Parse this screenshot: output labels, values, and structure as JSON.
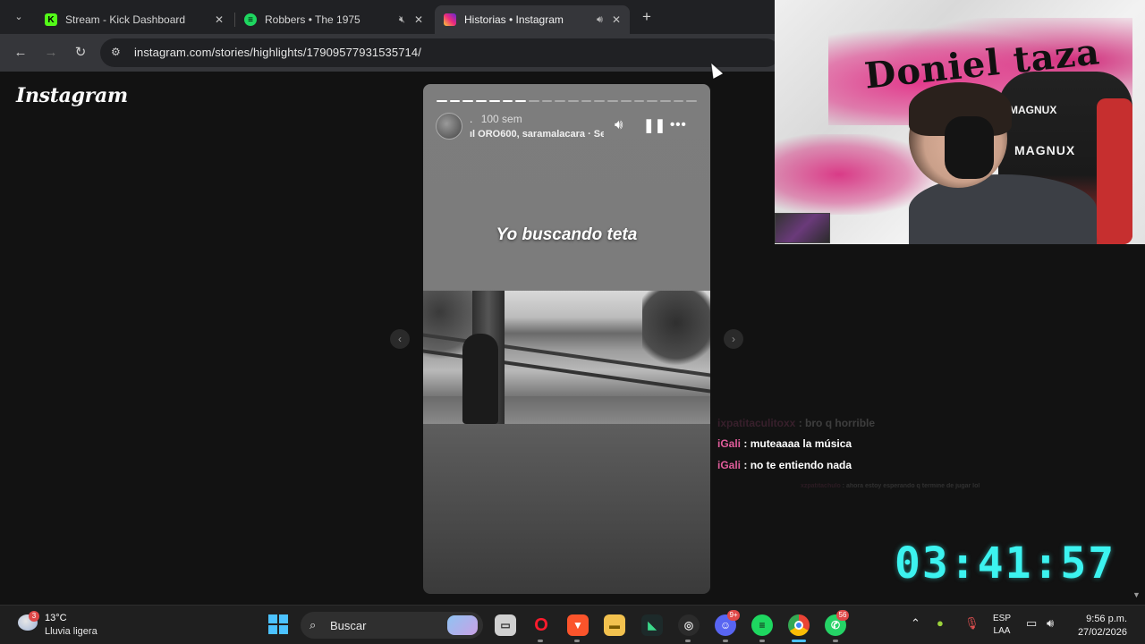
{
  "browser": {
    "tabs": [
      {
        "label": "Stream - Kick Dashboard",
        "favicon": "kick-icon",
        "color": "#53fc18",
        "active": false
      },
      {
        "label": "Robbers • The 1975",
        "favicon": "spotify-icon",
        "color": "#1ed760",
        "active": false
      },
      {
        "label": "Historias • Instagram",
        "favicon": "instagram-icon",
        "color": "#e1306c",
        "active": true
      }
    ],
    "url": "instagram.com/stories/highlights/17909577931535714/"
  },
  "instagram": {
    "logo": "Instagram",
    "story": {
      "username": ".",
      "time": "100 sem",
      "music": "ORO600, saramalacara · Se",
      "caption": "Yo buscando teta",
      "progress_done": 7,
      "progress_total": 20
    }
  },
  "stream_overlay": {
    "webcam_wall_text": "Doniel taza",
    "chair_brand": "MAGNUX",
    "chat": [
      {
        "user": "ixpatitaculitoxx",
        "message": "bro q horrible",
        "faded": true
      },
      {
        "user": "iGali",
        "message": "muteaaaa la música",
        "faded": false
      },
      {
        "user": "iGali",
        "message": "no te entiendo nada",
        "faded": false
      },
      {
        "user": "xzpatitachulo",
        "message": "ahora estoy esperando q termine de jugar lol",
        "faded": true
      }
    ],
    "timer": "03:41:57",
    "timer_color": "#3cf3f0"
  },
  "taskbar": {
    "weather": {
      "temp": "13°C",
      "desc": "Lluvia ligera",
      "badge": "3"
    },
    "search_placeholder": "Buscar",
    "apps": [
      {
        "name": "file-manager-icon",
        "badge": ""
      },
      {
        "name": "opera-icon",
        "badge": ""
      },
      {
        "name": "brave-icon",
        "badge": ""
      },
      {
        "name": "folder-icon",
        "badge": ""
      },
      {
        "name": "app-icon",
        "badge": ""
      },
      {
        "name": "obs-icon",
        "badge": ""
      },
      {
        "name": "discord-icon",
        "badge": "9+"
      },
      {
        "name": "spotify-icon",
        "badge": ""
      },
      {
        "name": "chrome-icon",
        "badge": ""
      },
      {
        "name": "whatsapp-icon",
        "badge": "56"
      }
    ],
    "lang_line1": "ESP",
    "lang_line2": "LAA",
    "time": "9:56 p.m.",
    "date": "27/02/2026"
  }
}
